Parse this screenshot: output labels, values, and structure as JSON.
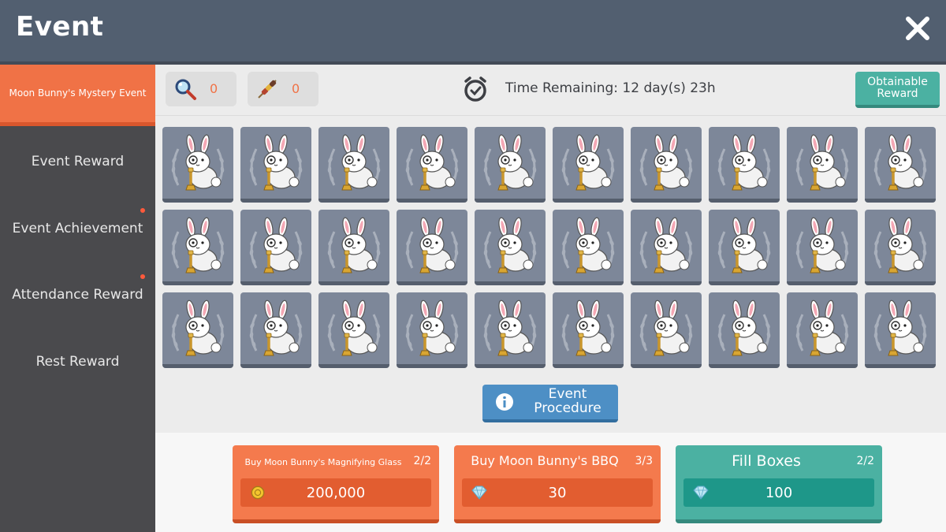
{
  "header": {
    "title": "Event"
  },
  "sidebar": {
    "items": [
      {
        "label": "Moon Bunny's Mystery Event",
        "active": true,
        "badge": false
      },
      {
        "label": "Event Reward",
        "active": false,
        "badge": false
      },
      {
        "label": "Event Achievement",
        "active": false,
        "badge": true
      },
      {
        "label": "Attendance Reward",
        "active": false,
        "badge": true
      },
      {
        "label": "Rest Reward",
        "active": false,
        "badge": false
      }
    ]
  },
  "toolbar": {
    "magnifier_count": "0",
    "bbq_count": "0",
    "time_remaining": "Time Remaining: 12 day(s) 23h",
    "obtainable_reward_label": "Obtainable Reward"
  },
  "grid": {
    "rows": 3,
    "columns": 10,
    "tile_icon": "moon-bunny-icon"
  },
  "event_procedure_label": "Event Procedure",
  "purchases": [
    {
      "label": "Buy Moon Bunny's Magnifying Glass",
      "count": "2/2",
      "price": "200,000",
      "currency_icon": "meso-coin-icon"
    },
    {
      "label": "Buy Moon Bunny's BBQ",
      "count": "3/3",
      "price": "30",
      "currency_icon": "crystal-icon"
    },
    {
      "label": "Fill Boxes",
      "count": "2/2",
      "price": "100",
      "currency_icon": "crystal-icon"
    }
  ],
  "colors": {
    "accent_orange": "#f07246",
    "teal": "#4bb1a2",
    "header": "#525f70",
    "sidebar": "#4a4a4d"
  }
}
